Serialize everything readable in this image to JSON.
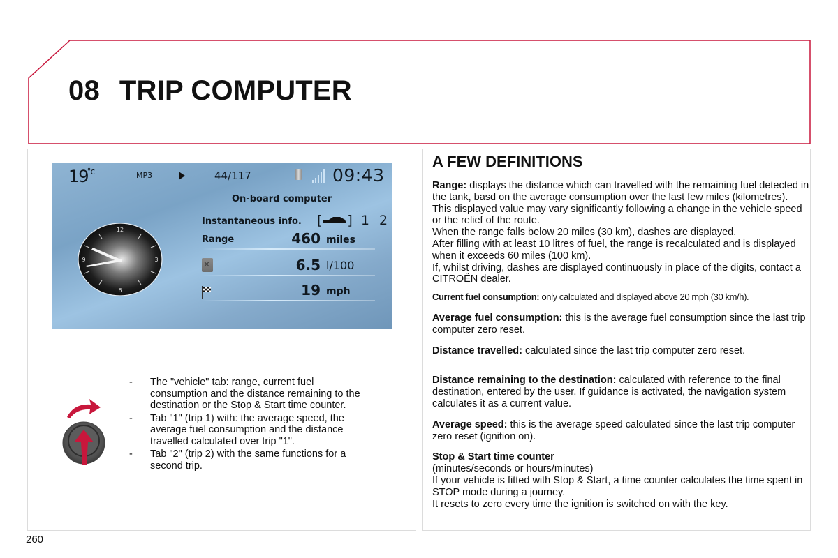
{
  "header": {
    "chapter_number": "08",
    "chapter_title": "TRIP COMPUTER",
    "accent_color": "#c8173c"
  },
  "screen": {
    "temperature": "19",
    "temperature_unit": "°c",
    "source": "MP3",
    "source_icon": "play-icon",
    "track": "44/117",
    "phone_icon": "phone-icon",
    "signal_icon": "signal-strength-icon",
    "time": "09:43",
    "analog_clock": {
      "numerals": [
        "12",
        "3",
        "6",
        "9"
      ],
      "time_shown": "09:43"
    },
    "title": "On-board computer",
    "tab_row_label": "Instantaneous info.",
    "tabs": [
      {
        "icon": "car-icon",
        "label": ""
      },
      {
        "label": "1"
      },
      {
        "label": "2"
      }
    ],
    "rows": [
      {
        "label": "Range",
        "value": "460",
        "unit": "miles"
      },
      {
        "icon": "fuel-pump-icon",
        "value": "6.5",
        "unit": "l/100"
      },
      {
        "icon": "chequered-flag-icon",
        "value": "19",
        "unit": "mph"
      }
    ]
  },
  "tab_list": {
    "items": [
      {
        "bullet": "-",
        "text": "The \"vehicle\" tab: range, current fuel consumption and the distance remaining to the destination or the Stop & Start time counter."
      },
      {
        "bullet": "-",
        "text": "Tab \"1\" (trip 1) with: the average speed, the average fuel consumption and the distance travelled calculated over trip \"1\"."
      },
      {
        "bullet": "-",
        "text": "Tab \"2\" (trip 2) with the same functions for a second trip."
      }
    ]
  },
  "definitions": {
    "title": "A FEW DEFINITIONS",
    "range": {
      "term": "Range:",
      "lines": [
        "displays the distance which can travelled with the remaining fuel detected in the tank, basd on the average consumption over the last few miles (kilometres).",
        "This displayed value may vary significantly following a change in the vehicle speed or the relief of the route.",
        "When the range falls below 20 miles (30 km), dashes are displayed.",
        "After filling with at least 10 litres of fuel, the range is recalculated and is displayed when it exceeds 60 miles (100 km).",
        "If, whilst driving, dashes are displayed continuously in place of the digits, contact a CITROËN dealer."
      ]
    },
    "current_fuel": {
      "term": "Current fuel consumption:",
      "text": "only calculated and displayed above 20 mph (30 km/h)."
    },
    "average_fuel": {
      "term": "Average fuel consumption:",
      "text": "this is the average fuel consumption since the last trip computer zero reset."
    },
    "distance_travelled": {
      "term": "Distance travelled:",
      "text": "calculated since the last trip computer zero reset."
    },
    "distance_remaining": {
      "term": "Distance remaining to the destination:",
      "text": "calculated with reference to the final destination, entered by the user. If guidance is activated, the navigation system calculates it as a current value."
    },
    "average_speed": {
      "term": "Average speed:",
      "text": "this is the average speed calculated since the last trip computer zero reset (ignition on)."
    },
    "stop_start": {
      "term": "Stop & Start time counter",
      "lines": [
        "(minutes/seconds or hours/minutes)",
        "If your vehicle is fitted with Stop & Start, a time counter calculates the time spent in STOP mode during a journey.",
        "It resets to zero every time the ignition is switched on with the key."
      ]
    }
  },
  "page_number": "260"
}
